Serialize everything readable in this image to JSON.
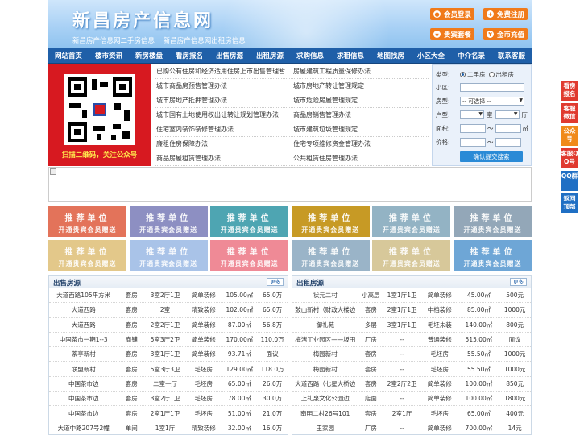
{
  "header": {
    "site_title": "新昌房产信息网",
    "links": [
      "新昌房产信息网二手房信息",
      "新昌房产信息网出租房信息"
    ],
    "buttons": [
      {
        "label": "会员登录",
        "icon": "user-icon"
      },
      {
        "label": "免费注册",
        "icon": "register-icon"
      },
      {
        "label": "贵宾套餐",
        "icon": "vip-icon"
      },
      {
        "label": "金币充值",
        "icon": "coin-icon"
      }
    ],
    "button_color": "#f07a1a"
  },
  "nav": [
    "网站首页",
    "楼市资讯",
    "新房楼盘",
    "看房报名",
    "出售房源",
    "出租房源",
    "求购信息",
    "求租信息",
    "地图找房",
    "小区大全",
    "中介名录",
    "联系客服"
  ],
  "qr": {
    "caption": "扫描二维码，关注公众号"
  },
  "regulations": [
    [
      "已购公有住房和经济适用住房上市出售管理暂",
      "房屋建筑工程质量保修办法"
    ],
    [
      "城市商品房预售管理办法",
      "城市房地产转让管理规定"
    ],
    [
      "城市房地产抵押管理办法",
      "城市危险房屋管理规定"
    ],
    [
      "城市国有土地使用权出让转让规划管理办法",
      "商品房销售管理办法"
    ],
    [
      "住宅室内装饰装修管理办法",
      "城市建筑垃圾管理规定"
    ],
    [
      "廉租住房保障办法",
      "住宅专项维修资金管理办法"
    ],
    [
      "商品房屋租赁管理办法",
      "公共租赁住房管理办法"
    ]
  ],
  "search": {
    "type_label": "类型:",
    "type_options": [
      "二手房",
      "出租房"
    ],
    "community_label": "小区:",
    "house_type_label": "房型:",
    "house_type_value": "-- 可选择 --",
    "layout_label": "户型:",
    "room_unit": "室",
    "hall_unit": "厅",
    "area_label": "面积:",
    "area_unit": "㎡",
    "price_label": "价格:",
    "range_sep": "～",
    "submit": "确认提交搜索"
  },
  "recommend": {
    "title": "推荐单位",
    "subtitle": "开通贵宾会员赠送",
    "colors": [
      "#e3735a",
      "#8d8fc2",
      "#4ea5b2",
      "#c79a25",
      "#93b3c4",
      "#93a7b8",
      "#e3c88a",
      "#a9c3e8",
      "#ef8a96",
      "#9ab4c8",
      "#d7c89a",
      "#6ea6d6"
    ]
  },
  "sale": {
    "title": "出售房源",
    "more": "更多",
    "rows": [
      [
        "大道西路105平方米",
        "套房",
        "3室2厅1卫",
        "简单装修",
        "105.00㎡",
        "65.0万"
      ],
      [
        "大道西路",
        "套房",
        "2室",
        "精致装修",
        "102.00㎡",
        "65.0万"
      ],
      [
        "大道西路",
        "套房",
        "2室2厅1卫",
        "简单装修",
        "87.00㎡",
        "56.8万"
      ],
      [
        "中国茶市一期1--3",
        "商铺",
        "5室3厅2卫",
        "简单装修",
        "170.00㎡",
        "110.0万"
      ],
      [
        "茶亭新村",
        "套房",
        "3室1厅1卫",
        "简单装修",
        "93.71㎡",
        "面议"
      ],
      [
        "联盟新村",
        "套房",
        "5室3厅3卫",
        "毛坯房",
        "129.00㎡",
        "118.0万"
      ],
      [
        "中国茶市边",
        "套房",
        "二室一厅",
        "毛坯房",
        "65.00㎡",
        "26.0万"
      ],
      [
        "中国茶市边",
        "套房",
        "3室2厅1卫",
        "毛坯房",
        "78.00㎡",
        "30.0万"
      ],
      [
        "中国茶市边",
        "套房",
        "2室1厅1卫",
        "毛坯房",
        "51.00㎡",
        "21.0万"
      ],
      [
        "大道中路207号2幢",
        "单间",
        "1室1厅",
        "精致装修",
        "32.00㎡",
        "16.0万"
      ]
    ]
  },
  "rent": {
    "title": "出租房源",
    "more": "更多",
    "rows": [
      [
        "状元二村",
        "小高层",
        "1室1厅1卫",
        "简单装修",
        "45.00㎡",
        "500元"
      ],
      [
        "鼓山新村（财政大楼边",
        "套房",
        "2室1厅1卫",
        "中档装修",
        "85.00㎡",
        "1000元"
      ],
      [
        "御礼苑",
        "多层",
        "3室1厅1卫",
        "毛坯未装",
        "140.00㎡",
        "800元"
      ],
      [
        "梅渚工业园区——坂田",
        "厂房",
        "--",
        "普通装修",
        "515.00㎡",
        "面议"
      ],
      [
        "梅园新村",
        "套房",
        "--",
        "毛坯房",
        "55.50㎡",
        "1000元"
      ],
      [
        "梅园新村",
        "套房",
        "--",
        "毛坯房",
        "55.50㎡",
        "1000元"
      ],
      [
        "大道西路（七星大桥边",
        "套房",
        "2室2厅2卫",
        "简单装修",
        "100.00㎡",
        "850元"
      ],
      [
        "上礼泉文化公园边",
        "店面",
        "--",
        "简单装修",
        "100.00㎡",
        "1800元"
      ],
      [
        "南明二村26号101",
        "套房",
        "2室1厅",
        "毛坯房",
        "65.00㎡",
        "400元"
      ],
      [
        "王家园",
        "厂房",
        "--",
        "简单装修",
        "700.00㎡",
        "14元"
      ]
    ]
  },
  "side": [
    {
      "label": "看房报名",
      "color": "red"
    },
    {
      "label": "客服微信",
      "color": "red"
    },
    {
      "label": "公众号",
      "color": "orange"
    },
    {
      "label": "客服QQ号",
      "color": "red"
    },
    {
      "label": "QQ群",
      "color": "blue"
    },
    {
      "label": "返回顶部",
      "color": "blue"
    }
  ]
}
